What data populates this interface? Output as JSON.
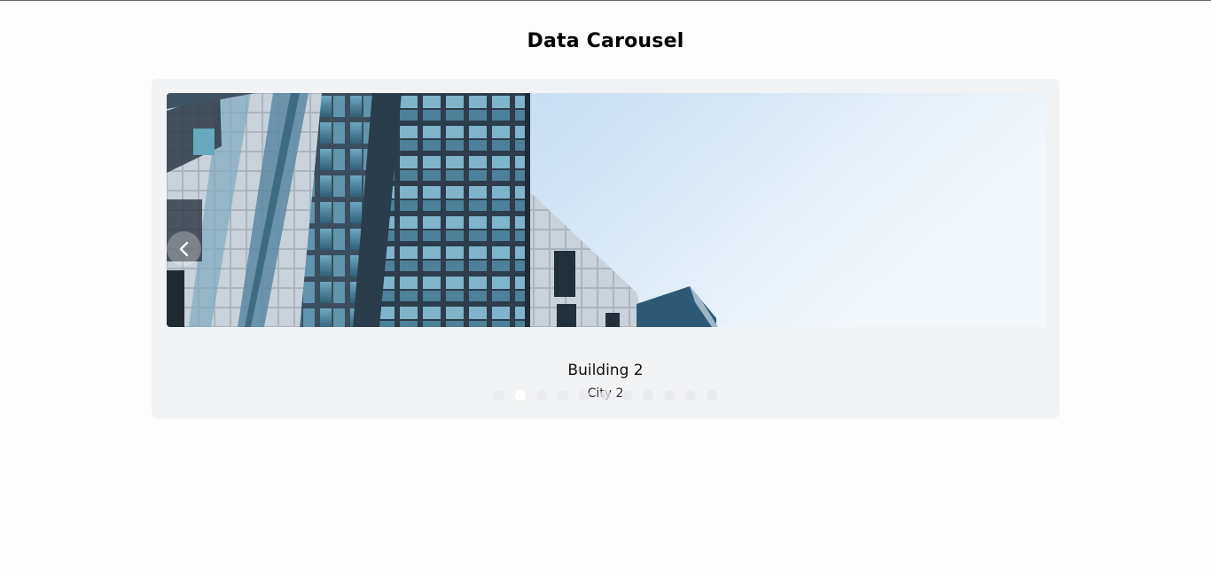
{
  "page": {
    "title": "Data Carousel"
  },
  "carousel": {
    "active_index": 1,
    "slide_count": 11,
    "slide": {
      "title": "Building 2",
      "subtitle": "City 2",
      "image_icon": "building-photo"
    },
    "prev_icon": "chevron-left-icon",
    "colors": {
      "panel_bg": "#f2f3f5",
      "dot_active": "#ffffff",
      "dot_inactive": "#e6e8eb"
    }
  }
}
